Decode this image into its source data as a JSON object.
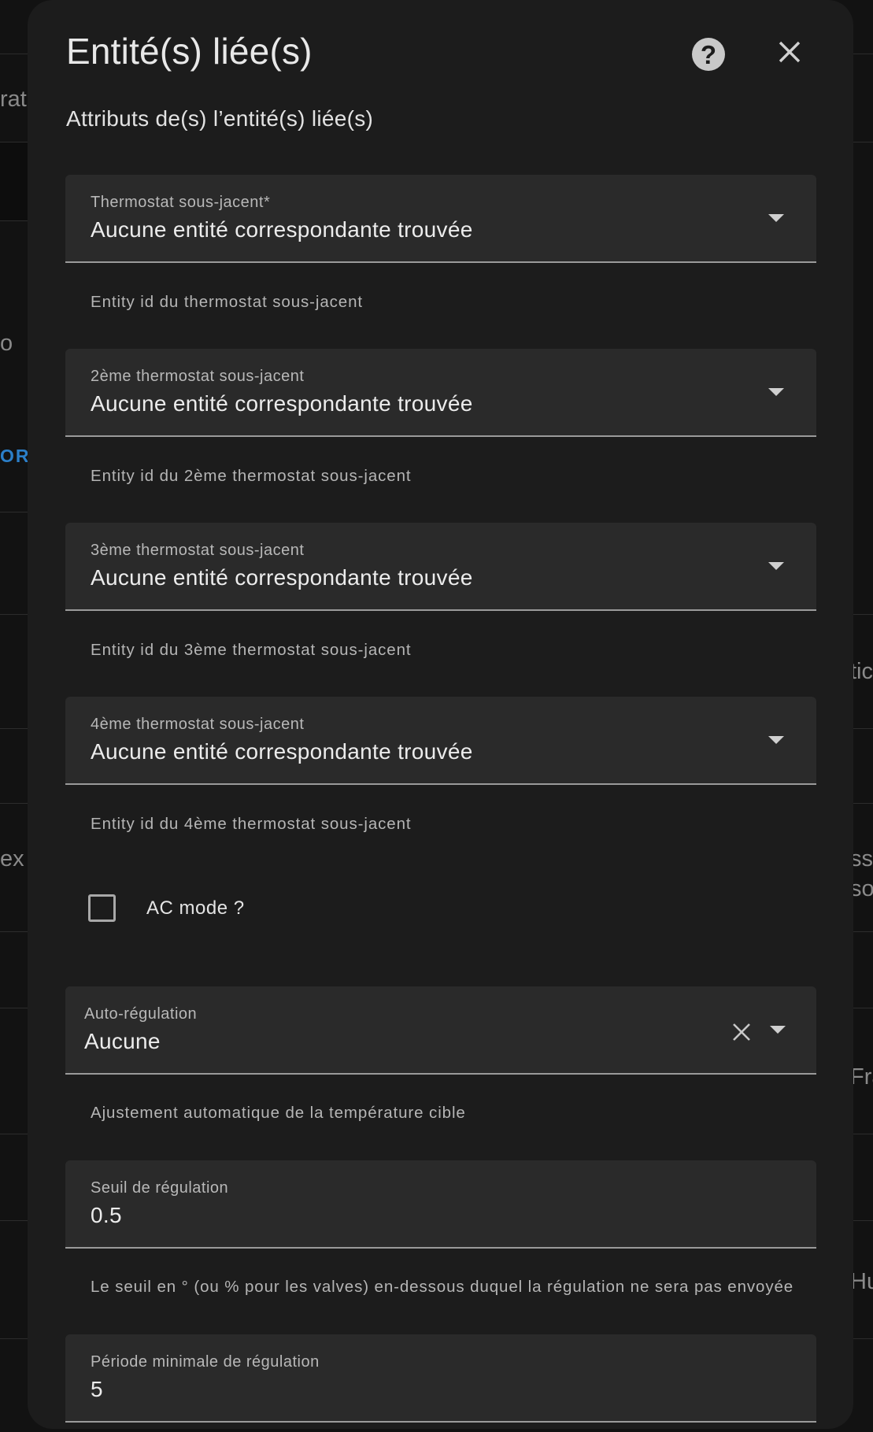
{
  "background": {
    "fragments": [
      "rat",
      "o",
      "OR",
      "ex",
      "tic",
      "ss",
      "so",
      "Fra",
      "Hu"
    ]
  },
  "dialog": {
    "title": "Entité(s) liée(s)",
    "help_glyph": "?",
    "section_title": "Attributs de(s) l’entité(s) liée(s)",
    "thermostats": [
      {
        "label": "Thermostat sous-jacent*",
        "value": "Aucune entité correspondante trouvée",
        "helper": "Entity id du thermostat sous-jacent"
      },
      {
        "label": "2ème thermostat sous-jacent",
        "value": "Aucune entité correspondante trouvée",
        "helper": "Entity id du 2ème thermostat sous-jacent"
      },
      {
        "label": "3ème thermostat sous-jacent",
        "value": "Aucune entité correspondante trouvée",
        "helper": "Entity id du 3ème thermostat sous-jacent"
      },
      {
        "label": "4ème thermostat sous-jacent",
        "value": "Aucune entité correspondante trouvée",
        "helper": "Entity id du 4ème thermostat sous-jacent"
      }
    ],
    "ac_mode": {
      "label": "AC mode ?",
      "checked": false
    },
    "auto_regulation": {
      "label": "Auto-régulation",
      "value": "Aucune",
      "helper": "Ajustement automatique de la température cible"
    },
    "regulation_threshold": {
      "label": "Seuil de régulation",
      "value": "0.5",
      "helper": "Le seuil en ° (ou % pour les valves) en-dessous duquel la régulation ne sera pas envoyée"
    },
    "min_regulation_period": {
      "label": "Période minimale de régulation",
      "value": "5"
    }
  }
}
